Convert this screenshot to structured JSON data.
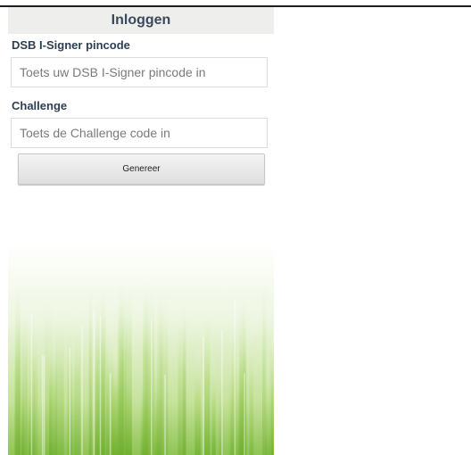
{
  "header": {
    "title": "Inloggen"
  },
  "form": {
    "pin_label": "DSB I-Signer pincode",
    "pin_placeholder": "Toets uw DSB I-Signer pincode in",
    "pin_value": "",
    "challenge_label": "Challenge",
    "challenge_placeholder": "Toets de Challenge code in",
    "challenge_value": "",
    "generate_label": "Genereer"
  },
  "colors": {
    "title_bar": "#eeeeec",
    "label_text": "#2e3e52",
    "grass_light": "#d9ecb8",
    "grass_dark": "#7fbb3e"
  },
  "decor": {
    "background": "green-grass-gradient"
  }
}
